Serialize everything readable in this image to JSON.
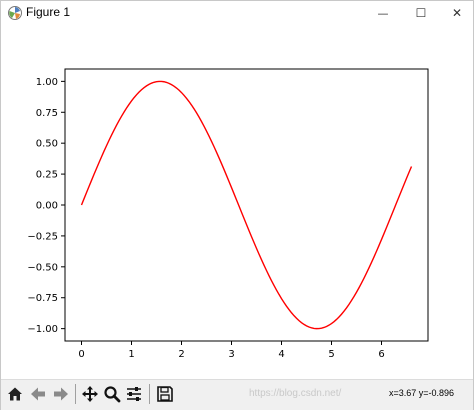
{
  "window": {
    "title": "Figure 1",
    "minimize_glyph": "—",
    "maximize_glyph": "☐",
    "close_glyph": "✕"
  },
  "toolbar": {
    "buttons": [
      {
        "icon": "home-icon"
      },
      {
        "icon": "back-arrow-icon"
      },
      {
        "icon": "forward-arrow-icon"
      },
      {
        "icon": "pan-icon"
      },
      {
        "icon": "zoom-icon"
      },
      {
        "icon": "configure-subplots-icon"
      },
      {
        "icon": "save-icon"
      }
    ],
    "coords": "x=3.67 y=-0.896",
    "watermark": "https://blog.csdn.net/"
  },
  "chart_data": {
    "type": "line",
    "title": "",
    "xlabel": "",
    "ylabel": "",
    "xlim": [
      -0.33,
      6.93
    ],
    "ylim": [
      -1.1,
      1.1
    ],
    "xticks": [
      0,
      1,
      2,
      3,
      4,
      5,
      6
    ],
    "xtick_labels": [
      "0",
      "1",
      "2",
      "3",
      "4",
      "5",
      "6"
    ],
    "yticks": [
      -1.0,
      -0.75,
      -0.5,
      -0.25,
      0.0,
      0.25,
      0.5,
      0.75,
      1.0
    ],
    "ytick_labels": [
      "−1.00",
      "−0.75",
      "−0.50",
      "−0.25",
      "0.00",
      "0.25",
      "0.50",
      "0.75",
      "1.00"
    ],
    "grid": false,
    "series": [
      {
        "color": "#ff0000",
        "function": "sin(x)",
        "x_start": 0,
        "x_end": 6.6,
        "x_step": 0.05
      }
    ]
  }
}
